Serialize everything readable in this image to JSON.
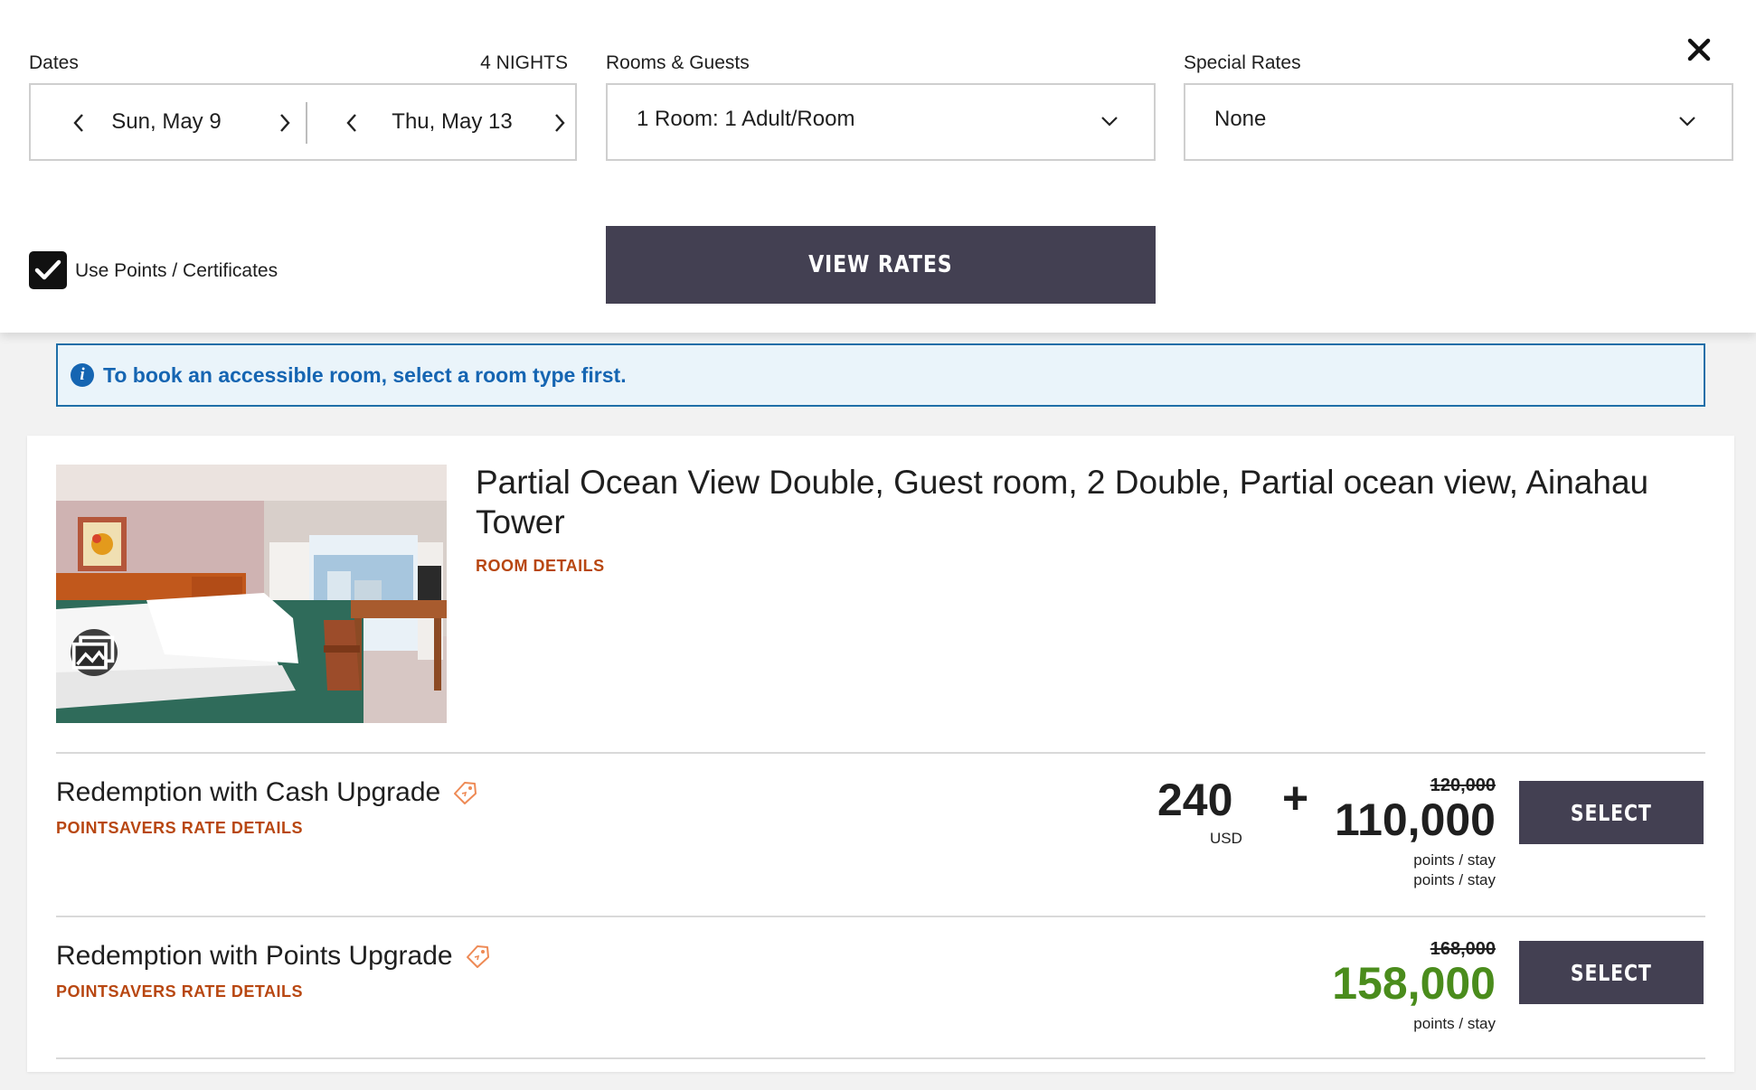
{
  "search": {
    "dates_label": "Dates",
    "nights_label": "4 NIGHTS",
    "check_in": "Sun, May 9",
    "check_out": "Thu, May 13",
    "rooms_label": "Rooms & Guests",
    "rooms_value": "1 Room: 1 Adult/Room",
    "special_rates_label": "Special Rates",
    "special_rates_value": "None",
    "use_points_label": "Use Points / Certificates",
    "use_points_checked": true,
    "view_rates_label": "VIEW RATES"
  },
  "info_bar": {
    "icon": "info-icon",
    "icon_glyph": "i",
    "text": "To book an accessible room, select a room type first."
  },
  "room": {
    "title": "Partial Ocean View Double, Guest room, 2 Double, Partial ocean view, Ainahau Tower",
    "details_link": "ROOM DETAILS",
    "photo_icon": "gallery-icon",
    "rates": [
      {
        "name": "Redemption with Cash Upgrade",
        "details_link": "POINTSAVERS RATE DETAILS",
        "cash_amount": "240",
        "cash_currency": "USD",
        "plus": "+",
        "old_points": "120,000",
        "points": "110,000",
        "points_unit_1": "points / stay",
        "points_unit_2": "points / stay",
        "select_label": "SELECT"
      },
      {
        "name": "Redemption with Points Upgrade",
        "details_link": "POINTSAVERS RATE DETAILS",
        "old_points": "168,000",
        "points": "158,000",
        "points_unit": "points / stay",
        "select_label": "SELECT"
      }
    ]
  },
  "colors": {
    "accent_button": "#434052",
    "link_orange": "#b84711",
    "info_blue": "#1565b2",
    "points_green": "#4a8c1c",
    "tag_orange": "#ee8a55"
  }
}
